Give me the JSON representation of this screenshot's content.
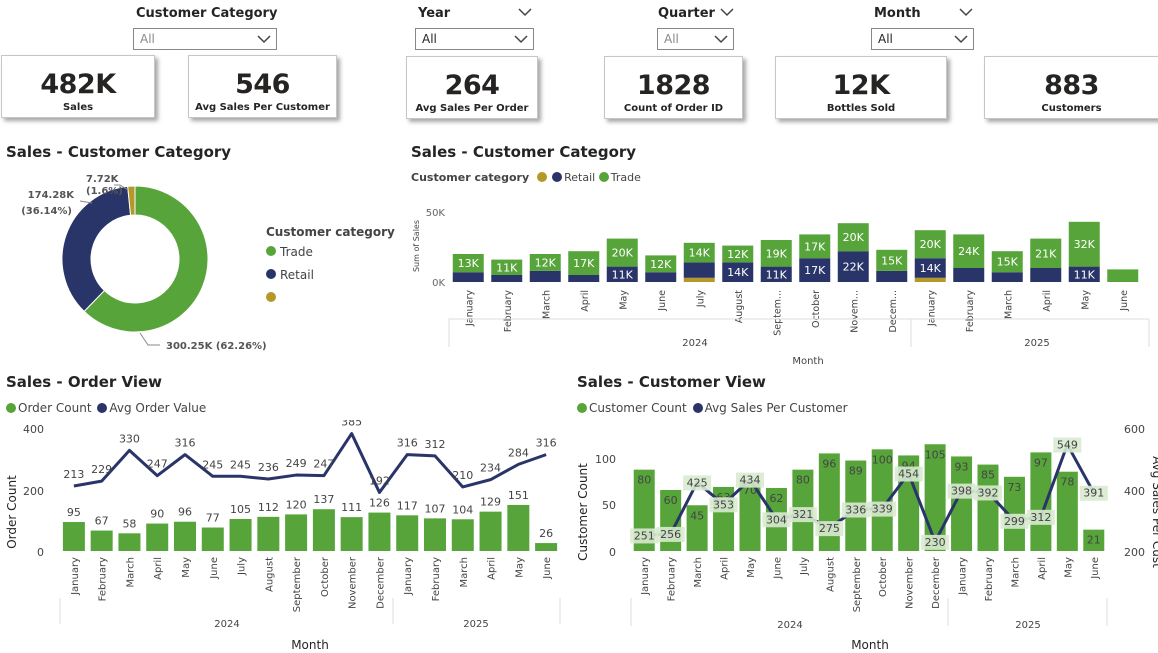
{
  "slicers": {
    "customer_category": {
      "label": "Customer Category",
      "value": "All"
    },
    "year": {
      "label": "Year",
      "value": "All"
    },
    "quarter": {
      "label": "Quarter",
      "value": "All"
    },
    "month": {
      "label": "Month",
      "value": "All"
    }
  },
  "cards": {
    "sales": {
      "value": "482K",
      "label": "Sales"
    },
    "avg_sales_customer": {
      "value": "546",
      "label": "Avg Sales Per Customer"
    },
    "avg_sales_order": {
      "value": "264",
      "label": "Avg Sales Per Order"
    },
    "order_count": {
      "value": "1828",
      "label": "Count of Order ID"
    },
    "bottles": {
      "value": "12K",
      "label": "Bottles Sold"
    },
    "customers": {
      "value": "883",
      "label": "Customers"
    }
  },
  "colors": {
    "trade": "#57a53a",
    "retail": "#293569",
    "other": "#b5982a",
    "light_line": "#c9d1e6"
  },
  "chart_data": [
    {
      "type": "pie",
      "title": "Sales - Customer Category",
      "legend_title": "Customer category",
      "legend": [
        "Trade",
        "Retail",
        ""
      ],
      "slices": [
        {
          "name": "Trade",
          "value": 300.25,
          "label": "300.25K (62.26%)",
          "color": "#57a53a"
        },
        {
          "name": "Retail",
          "value": 174.28,
          "label_value": "174.28K",
          "label_pct": "(36.14%)",
          "color": "#293569"
        },
        {
          "name": "",
          "value": 7.72,
          "label_value": "7.72K",
          "label_pct": "(1.6%)",
          "color": "#b5982a"
        }
      ]
    },
    {
      "type": "bar",
      "stacked": true,
      "title": "Sales - Customer Category",
      "legend_title": "Customer category",
      "legend": [
        "",
        "Retail",
        "Trade"
      ],
      "ylabel": "Sum of Sales",
      "xlabel": "Month",
      "y_ticks": [
        "50K",
        "0K"
      ],
      "ylim": [
        0,
        50
      ],
      "years": [
        "2024",
        "2025"
      ],
      "categories": [
        "January",
        "February",
        "March",
        "April",
        "May",
        "June",
        "July",
        "August",
        "Septem...",
        "October",
        "Novem...",
        "Decem...",
        "January",
        "February",
        "March",
        "April",
        "May",
        "June"
      ],
      "series": [
        {
          "name": "",
          "values": [
            0,
            0,
            0,
            0,
            0,
            0,
            3,
            0,
            0,
            0,
            0,
            0,
            3,
            0,
            0,
            0,
            0,
            0
          ]
        },
        {
          "name": "Retail",
          "values": [
            7,
            5,
            8,
            5,
            11,
            7,
            11,
            14,
            11,
            17,
            22,
            8,
            14,
            10,
            7,
            10,
            11,
            0
          ]
        },
        {
          "name": "Trade",
          "values": [
            13,
            11,
            12,
            17,
            20,
            12,
            14,
            12,
            19,
            17,
            20,
            15,
            20,
            24,
            15,
            21,
            32,
            9
          ]
        },
        {
          "name": "Retail labels",
          "values": [
            "",
            "",
            "",
            "",
            "11K",
            "",
            "",
            "14K",
            "11K",
            "17K",
            "22K",
            "",
            "14K",
            "",
            "",
            "",
            "11K",
            ""
          ]
        },
        {
          "name": "Trade labels",
          "values": [
            "13K",
            "11K",
            "12K",
            "17K",
            "20K",
            "12K",
            "14K",
            "12K",
            "19K",
            "17K",
            "20K",
            "15K",
            "20K",
            "24K",
            "15K",
            "21K",
            "32K",
            ""
          ]
        }
      ]
    },
    {
      "type": "bar",
      "combo": true,
      "title": "Sales - Order View",
      "legend": [
        "Order Count",
        "Avg Order Value"
      ],
      "ylabel": "Order Count",
      "xlabel": "Month",
      "y_ticks": [
        "400",
        "200",
        "0"
      ],
      "ylim": [
        0,
        400
      ],
      "y2lim": [
        0,
        400
      ],
      "years": [
        "2024",
        "2025"
      ],
      "categories": [
        "January",
        "February",
        "March",
        "April",
        "May",
        "June",
        "July",
        "August",
        "September",
        "October",
        "November",
        "December",
        "January",
        "February",
        "March",
        "April",
        "May",
        "June"
      ],
      "series": [
        {
          "name": "Order Count",
          "values": [
            95,
            67,
            58,
            90,
            96,
            77,
            105,
            112,
            120,
            137,
            111,
            126,
            117,
            107,
            104,
            129,
            151,
            26
          ]
        },
        {
          "name": "Avg Order Value",
          "values": [
            213,
            229,
            330,
            247,
            316,
            245,
            245,
            236,
            249,
            247,
            385,
            192,
            316,
            312,
            210,
            234,
            284,
            316
          ]
        }
      ]
    },
    {
      "type": "bar",
      "combo": true,
      "title": "Sales - Customer View",
      "legend": [
        "Customer Count",
        "Avg Sales Per Customer"
      ],
      "ylabel": "Customer Count",
      "y2label": "Avg Sales Per Cust",
      "xlabel": "Month",
      "y_ticks": [
        "100",
        "50",
        "0"
      ],
      "y2_ticks": [
        "600",
        "400",
        "200"
      ],
      "ylim": [
        0,
        120
      ],
      "y2lim": [
        200,
        600
      ],
      "years": [
        "2024",
        "2025"
      ],
      "categories": [
        "January",
        "February",
        "March",
        "April",
        "May",
        "June",
        "July",
        "August",
        "September",
        "October",
        "November",
        "December",
        "January",
        "February",
        "March",
        "April",
        "May",
        "June"
      ],
      "series": [
        {
          "name": "Customer Count",
          "values": [
            80,
            60,
            45,
            63,
            70,
            62,
            80,
            96,
            89,
            100,
            94,
            105,
            93,
            85,
            73,
            97,
            78,
            21
          ]
        },
        {
          "name": "Avg Sales Per Customer",
          "values": [
            251,
            256,
            425,
            353,
            434,
            304,
            321,
            275,
            336,
            339,
            454,
            230,
            398,
            392,
            299,
            312,
            549,
            391
          ]
        }
      ]
    }
  ]
}
